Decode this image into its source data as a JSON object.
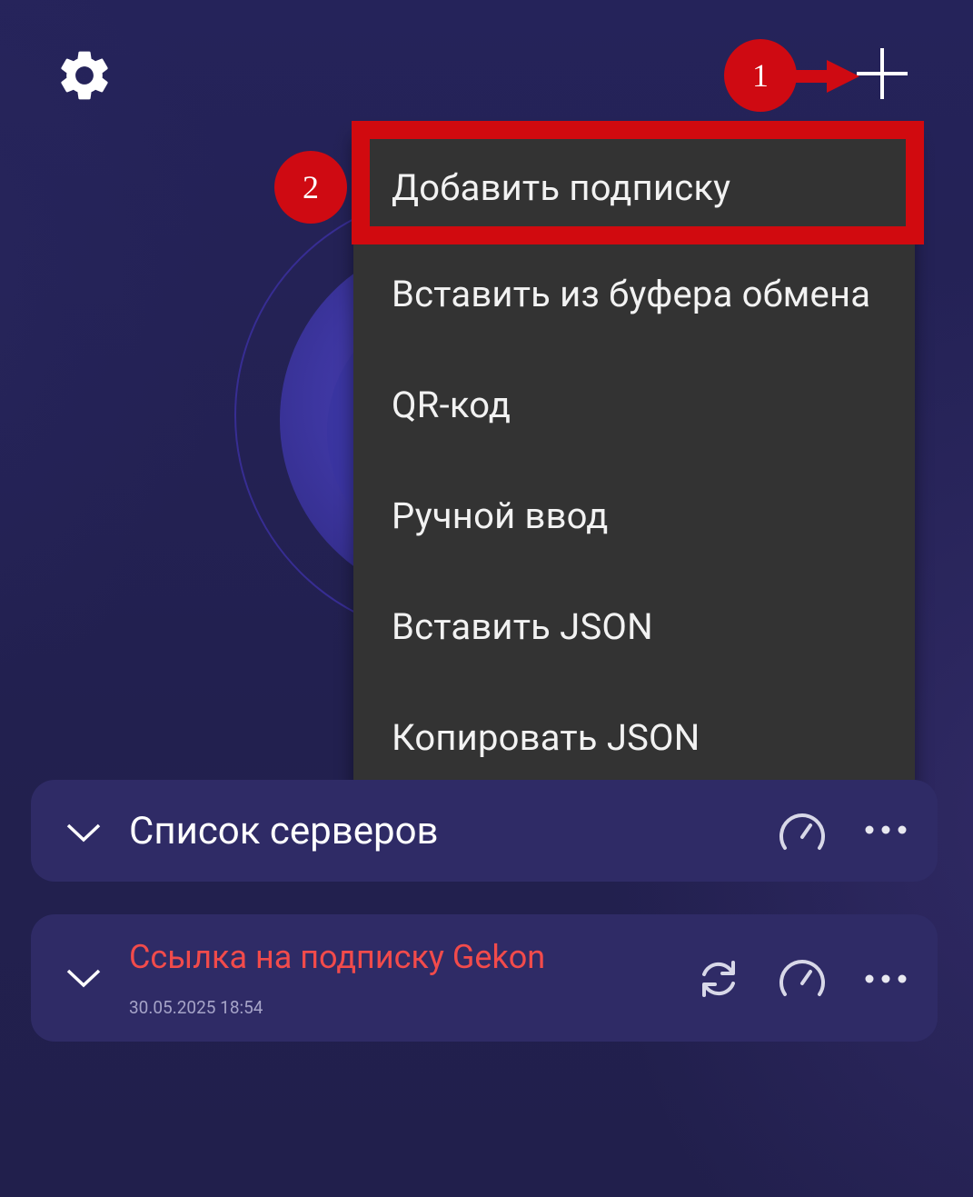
{
  "header": {
    "settings_icon": "gear-icon",
    "add_icon": "plus-icon"
  },
  "annotations": {
    "step1": "1",
    "step2": "2",
    "accent_color": "#cf0a12"
  },
  "menu": {
    "items": [
      {
        "label": "Добавить подписку"
      },
      {
        "label": "Вставить из буфера обмена"
      },
      {
        "label": "QR-код"
      },
      {
        "label": "Ручной ввод"
      },
      {
        "label": "Вставить JSON"
      },
      {
        "label": "Копировать JSON"
      }
    ],
    "background": "#333333"
  },
  "groups": [
    {
      "title": "Список серверов",
      "icons": [
        "chevron-down-icon",
        "speed-test-icon",
        "more-icon"
      ]
    },
    {
      "title": "Ссылка на подписку Gekon",
      "date": "30.05.2025 18:54",
      "title_color": "#f24b4b",
      "icons": [
        "chevron-down-icon",
        "refresh-icon",
        "speed-test-icon",
        "more-icon"
      ]
    }
  ]
}
